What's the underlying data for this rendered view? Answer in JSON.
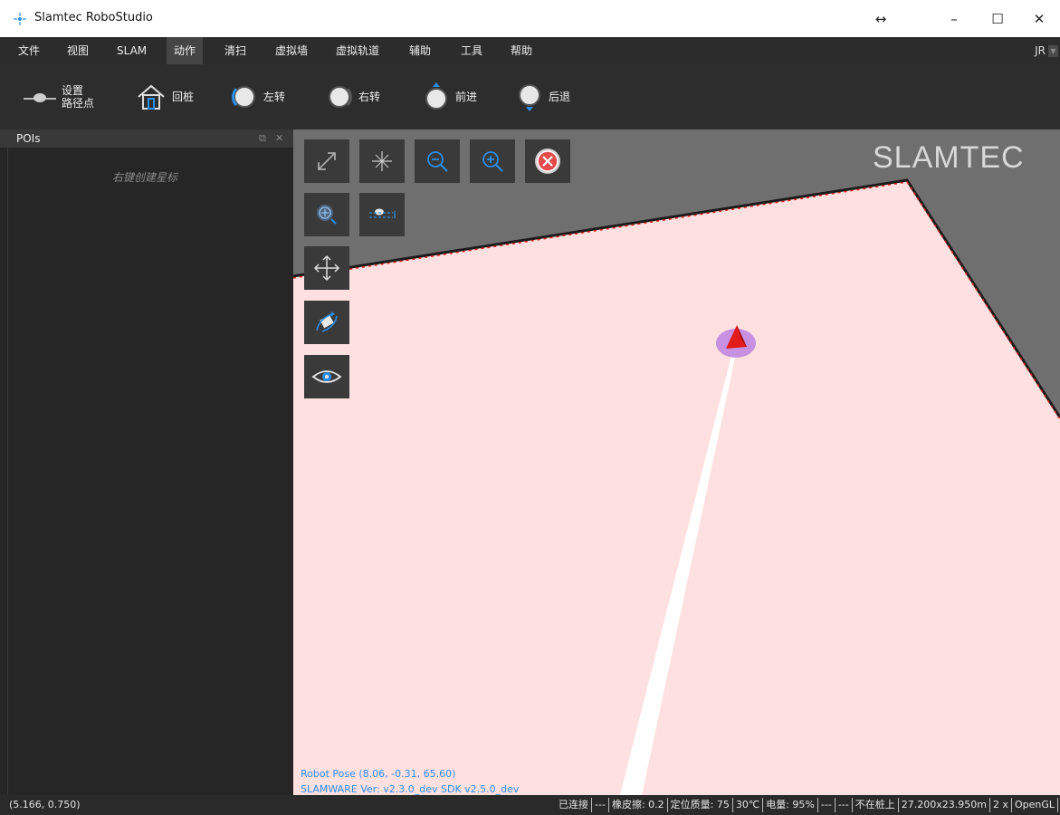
{
  "window": {
    "title": "Slamtec RoboStudio",
    "controls": {
      "restore_arrows": "↔",
      "minimize": "–",
      "maximize": "☐",
      "close": "✕"
    }
  },
  "menu": {
    "items": [
      "文件",
      "视图",
      "SLAM",
      "动作",
      "清扫",
      "虚拟墙",
      "虚拟轨道",
      "辅助",
      "工具",
      "帮助"
    ],
    "active": "动作",
    "user": "JR"
  },
  "toolbar": {
    "set_path_point_line1": "设置",
    "set_path_point_line2": "路径点",
    "go_home": "回桩",
    "turn_left": "左转",
    "turn_right": "右转",
    "forward": "前进",
    "backward": "后退"
  },
  "poi_panel": {
    "title": "POIs",
    "hint": "右键创建星标",
    "float_icon": "⧉",
    "close_icon": "✕"
  },
  "map": {
    "watermark": "SLAMTEC",
    "robot_pose": "Robot Pose (8.06, -0.31, 65.60)",
    "version": "SLAMWARE Ver: v2.3.0_dev  SDK  v2.5.0_dev",
    "floor_color": "#ffe0e0",
    "outside_color": "#6f6f6f",
    "accent_color": "#2a8ee8"
  },
  "statusbar": {
    "cursor_coord": "(5.166, 0.750)",
    "cells": [
      "已连接",
      "---",
      "橡皮擦: 0.2",
      "定位质量: 75",
      "30℃",
      "电量: 95%",
      "---",
      "---",
      "不在桩上",
      "27.200x23.950m",
      "2 x",
      "OpenGL"
    ]
  }
}
